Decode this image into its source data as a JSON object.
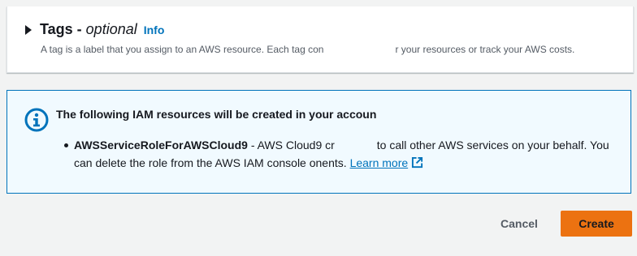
{
  "tags_section": {
    "title": "Tags - ",
    "title_optional": "optional",
    "info_link": "Info",
    "description_start": "A tag is a label that you assign to an AWS resource. Each tag con",
    "description_end": "r your resources or track your AWS costs."
  },
  "alert": {
    "heading": "The following IAM resources will be created in your accoun",
    "items": [
      {
        "role_name": "AWSServiceRoleForAWSCloud9",
        "text_part1": " - AWS Cloud9 cr",
        "text_part2": "to call other AWS services on your behalf. You can delete the role from the AWS IAM console onents. ",
        "learn_more": "Learn more"
      }
    ]
  },
  "footer": {
    "cancel_label": "Cancel",
    "create_label": "Create"
  },
  "colors": {
    "accent": "#0073bb",
    "primary_button": "#ec7211",
    "alert_background": "#f1faff"
  },
  "icons": {
    "expand": "caret-right-icon",
    "alert": "info-circle-icon",
    "external": "external-link-icon"
  }
}
